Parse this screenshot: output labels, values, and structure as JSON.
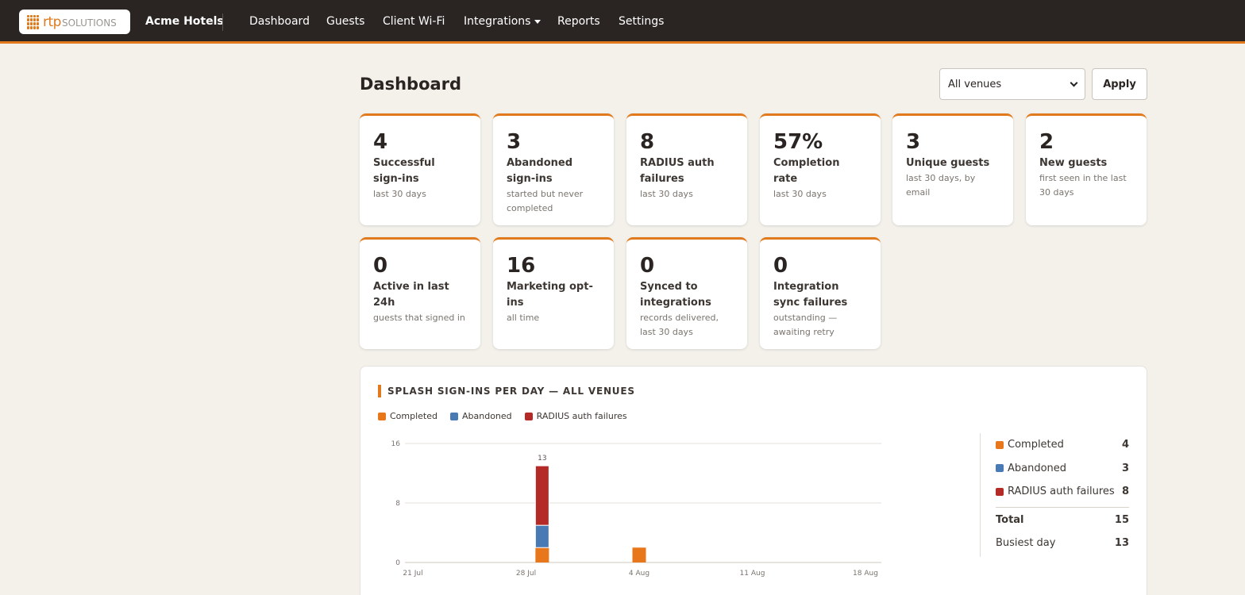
{
  "logo": {
    "rtp": "rtp",
    "solutions": "SOLUTIONS"
  },
  "nav": {
    "brand": "Acme Hotels",
    "items": [
      "Dashboard",
      "Guests",
      "Client Wi-Fi",
      "Integrations",
      "Reports",
      "Settings"
    ]
  },
  "header": {
    "title": "Dashboard",
    "venue_selected": "All venues",
    "apply_label": "Apply"
  },
  "cards": [
    {
      "value": "4",
      "label": "Successful sign-ins",
      "sub": "last 30 days"
    },
    {
      "value": "3",
      "label": "Abandoned sign-ins",
      "sub": "started but never completed"
    },
    {
      "value": "8",
      "label": "RADIUS auth failures",
      "sub": "last 30 days"
    },
    {
      "value": "57%",
      "label": "Completion rate",
      "sub": "last 30 days"
    },
    {
      "value": "3",
      "label": "Unique guests",
      "sub": "last 30 days, by email"
    },
    {
      "value": "2",
      "label": "New guests",
      "sub": "first seen in the last 30 days"
    },
    {
      "value": "0",
      "label": "Active in last 24h",
      "sub": "guests that signed in"
    },
    {
      "value": "16",
      "label": "Marketing opt-ins",
      "sub": "all time"
    },
    {
      "value": "0",
      "label": "Synced to integrations",
      "sub": "records delivered, last 30 days"
    },
    {
      "value": "0",
      "label": "Integration sync failures",
      "sub": "outstanding — awaiting retry"
    }
  ],
  "panel": {
    "title": "SPLASH SIGN-INS PER DAY — ALL VENUES"
  },
  "colors": {
    "completed": "#e8761a",
    "abandoned": "#4a7ab3",
    "radius": "#b32a26",
    "accent": "#e07a1c"
  },
  "chart_data": {
    "type": "bar",
    "stacked": true,
    "x_ticks": [
      "21 Jul",
      "28 Jul",
      "4 Aug",
      "11 Aug",
      "18 Aug"
    ],
    "y_ticks": [
      "0",
      "8",
      "16"
    ],
    "ylim": [
      0,
      16
    ],
    "xlim": [
      "21 Jul",
      "20 Aug"
    ],
    "series": [
      {
        "name": "Completed",
        "points": [
          {
            "x": "29 Jul",
            "y": 2
          },
          {
            "x": "4 Aug",
            "y": 2
          }
        ]
      },
      {
        "name": "Abandoned",
        "points": [
          {
            "x": "29 Jul",
            "y": 3
          }
        ]
      },
      {
        "name": "RADIUS auth failures",
        "points": [
          {
            "x": "29 Jul",
            "y": 8
          }
        ]
      }
    ],
    "data_labels": [
      {
        "x": "29 Jul",
        "text": "13"
      }
    ],
    "legend_position": "top-left",
    "grid": true
  },
  "summary": {
    "rows": [
      {
        "label": "Completed",
        "value": "4"
      },
      {
        "label": "Abandoned",
        "value": "3"
      },
      {
        "label": "RADIUS auth failures",
        "value": "8"
      }
    ],
    "total_label": "Total",
    "total_value": "15",
    "busiest_label": "Busiest day",
    "busiest_value": "13"
  }
}
